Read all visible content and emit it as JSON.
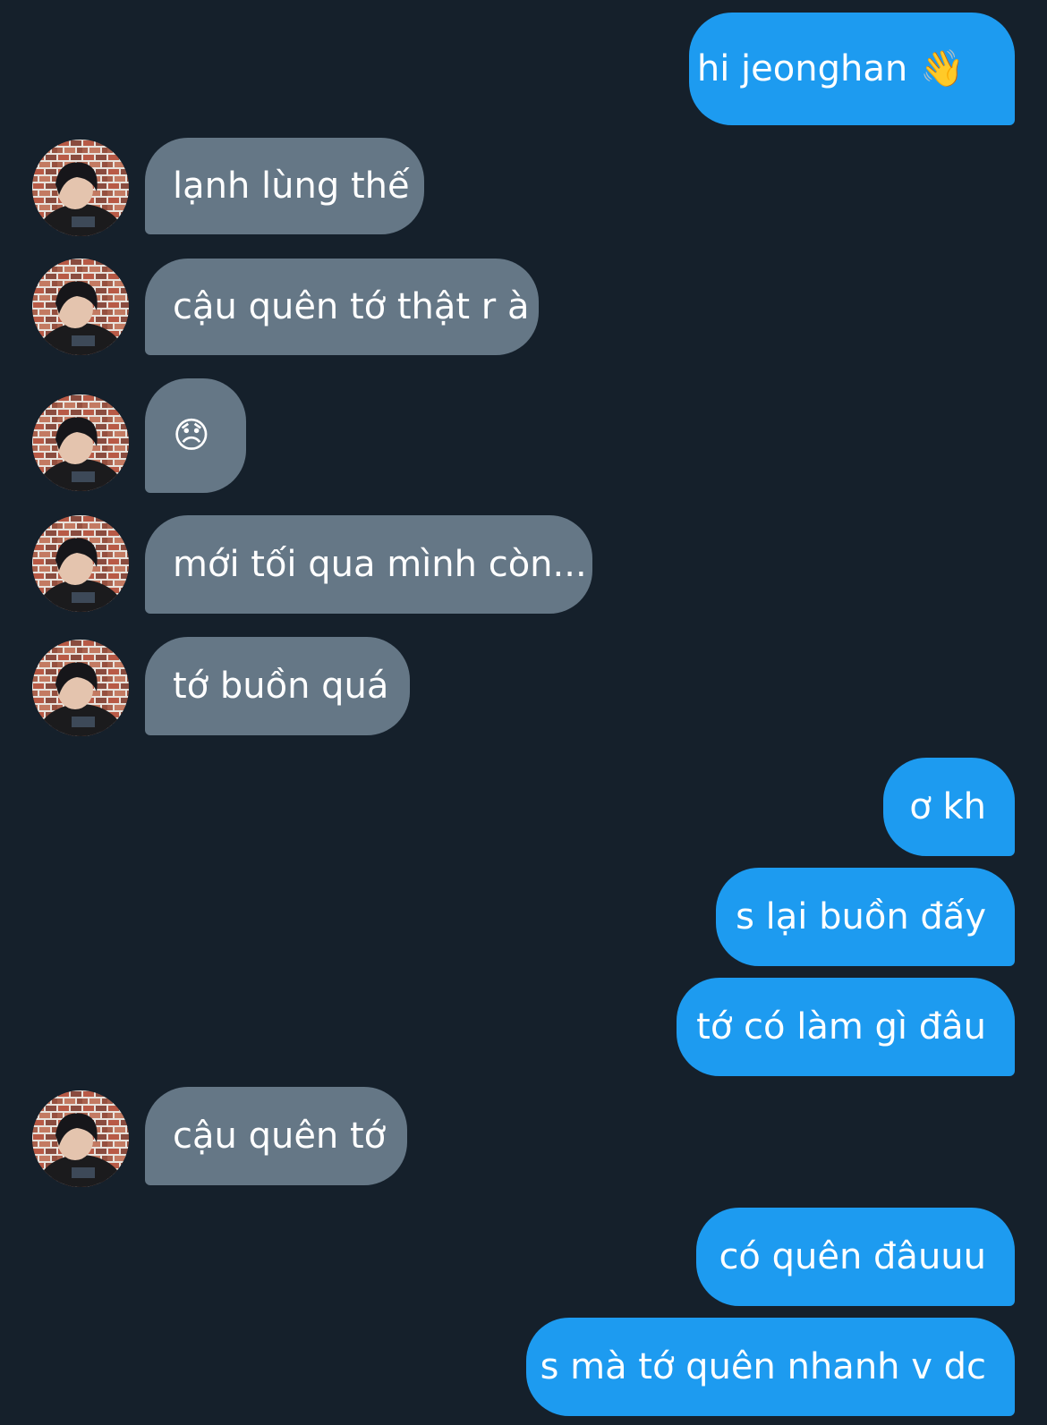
{
  "conversation": {
    "messages": [
      {
        "dir": "out",
        "text": "hi jeonghan",
        "emoji": "👋"
      },
      {
        "dir": "in",
        "text": "lạnh lùng thế"
      },
      {
        "dir": "in",
        "text": "cậu quên tớ thật r à"
      },
      {
        "dir": "in",
        "text": "😞"
      },
      {
        "dir": "in",
        "text": "mới tối qua mình còn..."
      },
      {
        "dir": "in",
        "text": "tớ buồn quá"
      },
      {
        "dir": "out",
        "text": "ơ kh"
      },
      {
        "dir": "out",
        "text": "s lại buồn đấy"
      },
      {
        "dir": "out",
        "text": "tớ có làm gì đâu"
      },
      {
        "dir": "in",
        "text": "cậu quên tớ"
      },
      {
        "dir": "out",
        "text": "có quên đâuuu"
      },
      {
        "dir": "out",
        "text": "s mà tớ quên nhanh v dc"
      }
    ]
  },
  "colors": {
    "background": "#15202b",
    "outgoing_bubble": "#1d9bf0",
    "incoming_bubble": "#657786",
    "text": "#ffffff"
  },
  "icons": {
    "avatar": "contact-avatar-photo"
  }
}
